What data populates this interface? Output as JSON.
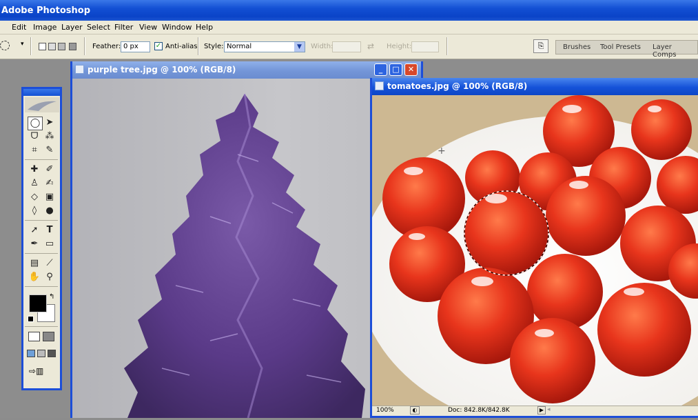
{
  "app": {
    "title": "Adobe Photoshop"
  },
  "menu": [
    "Edit",
    "Image",
    "Layer",
    "Select",
    "Filter",
    "View",
    "Window",
    "Help"
  ],
  "options": {
    "feather_label": "Feather:",
    "feather_value": "0 px",
    "antialias_label": "Anti-alias",
    "antialias_checked": true,
    "style_label": "Style:",
    "style_value": "Normal",
    "width_label": "Width:",
    "height_label": "Height:"
  },
  "palette_tabs": [
    "Brushes",
    "Tool Presets",
    "Layer Comps"
  ],
  "windows": {
    "tree": {
      "title": "purple tree.jpg @ 100% (RGB/8)"
    },
    "tomatoes": {
      "title": "tomatoes.jpg @ 100% (RGB/8)"
    }
  },
  "status": {
    "zoom": "100%",
    "doc": "Doc: 842.8K/842.8K"
  },
  "colors": {
    "foreground": "#000000",
    "background": "#ffffff",
    "accent": "#1c4ed8"
  }
}
